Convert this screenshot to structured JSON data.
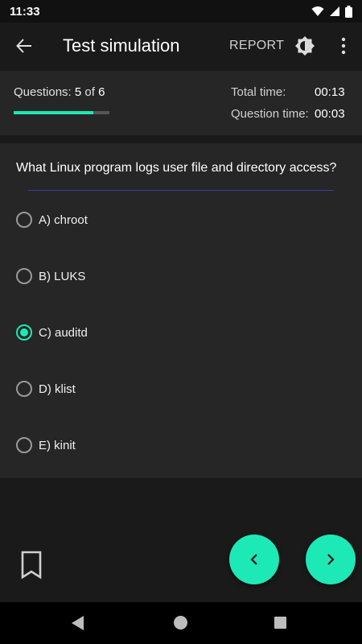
{
  "status_bar": {
    "time": "11:33"
  },
  "app_bar": {
    "title": "Test simulation",
    "report_label": "REPORT"
  },
  "info": {
    "questions_prefix": "Questions:",
    "current": "5",
    "of_word": "of",
    "total": "6",
    "progress_fraction": 0.83,
    "total_time_label": "Total time:",
    "total_time_value": "00:13",
    "question_time_label": "Question time:",
    "question_time_value": "00:03"
  },
  "question": {
    "text": "What Linux program logs user file and directory access?",
    "options": [
      {
        "label": "A) chroot",
        "selected": false
      },
      {
        "label": "B) LUKS",
        "selected": false
      },
      {
        "label": "C) auditd",
        "selected": true
      },
      {
        "label": "D) klist",
        "selected": false
      },
      {
        "label": "E) kinit",
        "selected": false
      }
    ]
  },
  "colors": {
    "accent": "#1de9b6",
    "background": "#1a1a1a",
    "card": "#262626"
  },
  "icons": {
    "back": "arrow-left-icon",
    "brightness": "brightness-icon",
    "more": "more-vert-icon",
    "bookmark": "bookmark-outline-icon",
    "prev": "chevron-left-icon",
    "next": "chevron-right-icon"
  }
}
